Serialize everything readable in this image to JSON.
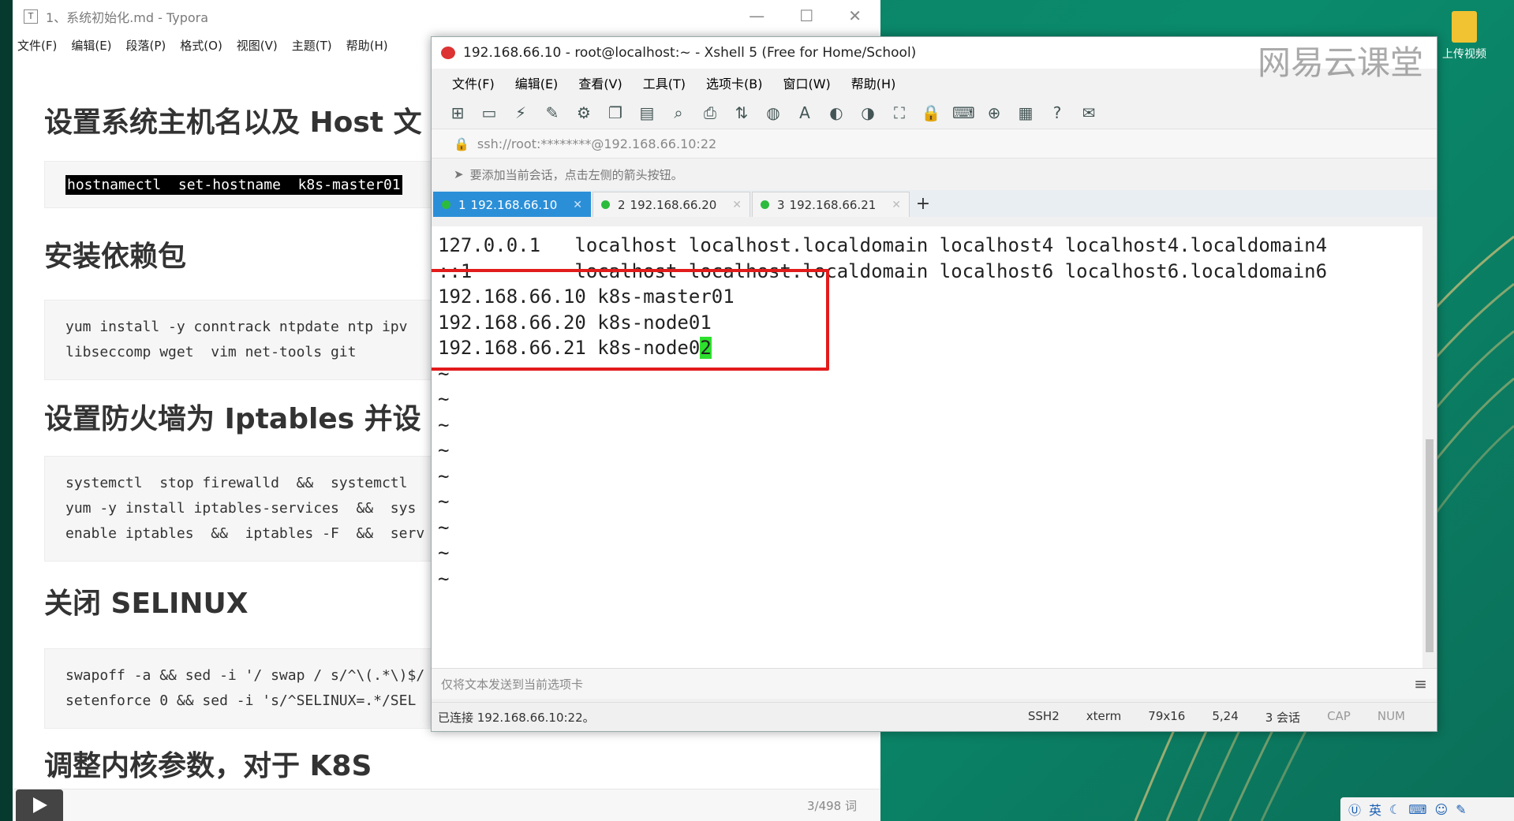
{
  "typora": {
    "title": "1、系统初始化.md - Typora",
    "menu": [
      "文件(F)",
      "编辑(E)",
      "段落(P)",
      "格式(O)",
      "视图(V)",
      "主题(T)",
      "帮助(H)"
    ],
    "headings": [
      "设置系统主机名以及 Host 文",
      "安装依赖包",
      "设置防火墙为 Iptables 并设",
      "关闭 SELINUX",
      "调整内核参数，对于 K8S"
    ],
    "code1": "hostnamectl  set-hostname  k8s-master01",
    "code2_line1": "yum install -y conntrack ntpdate ntp ipv",
    "code2_line2": "libseccomp wget  vim net-tools git",
    "code3_line1": "systemctl  stop firewalld  &&  systemctl",
    "code3_line2": "yum -y install iptables-services  &&  sys",
    "code3_line3": "enable iptables  &&  iptables -F  &&  serv",
    "code4_line1": "swapoff -a && sed -i '/ swap / s/^\\(.*\\)$/",
    "code4_line2": "setenforce 0 && sed -i 's/^SELINUX=.*/SEL",
    "word_count": "3/498 词"
  },
  "xshell": {
    "title": "192.168.66.10 - root@localhost:~ - Xshell 5 (Free for Home/School)",
    "menu": [
      "文件(F)",
      "编辑(E)",
      "查看(V)",
      "工具(T)",
      "选项卡(B)",
      "窗口(W)",
      "帮助(H)"
    ],
    "address": "ssh://root:********@192.168.66.10:22",
    "hint": "要添加当前会话，点击左侧的箭头按钮。",
    "tabs": [
      {
        "num": "1",
        "label": "192.168.66.10"
      },
      {
        "num": "2",
        "label": "192.168.66.20"
      },
      {
        "num": "3",
        "label": "192.168.66.21"
      }
    ],
    "terminal": {
      "line1": "127.0.0.1   localhost localhost.localdomain localhost4 localhost4.localdomain4",
      "line2": "::1         localhost localhost.localdomain localhost6 localhost6.localdomain6",
      "line3": "192.168.66.10 k8s-master01",
      "line4": "192.168.66.20 k8s-node01",
      "line5_prefix": "192.168.66.21 k8s-node0",
      "line5_cursor": "2",
      "tilde": "~"
    },
    "send_placeholder": "仅将文本发送到当前选项卡",
    "status": {
      "connected": "已连接 192.168.66.10:22。",
      "protocol": "SSH2",
      "term": "xterm",
      "size": "79x16",
      "pos": "5,24",
      "sessions": "3 会话",
      "caps": "CAP",
      "num": "NUM"
    }
  },
  "watermark": "网易云课堂",
  "desktop_upload": "上传视频",
  "tray": "英"
}
